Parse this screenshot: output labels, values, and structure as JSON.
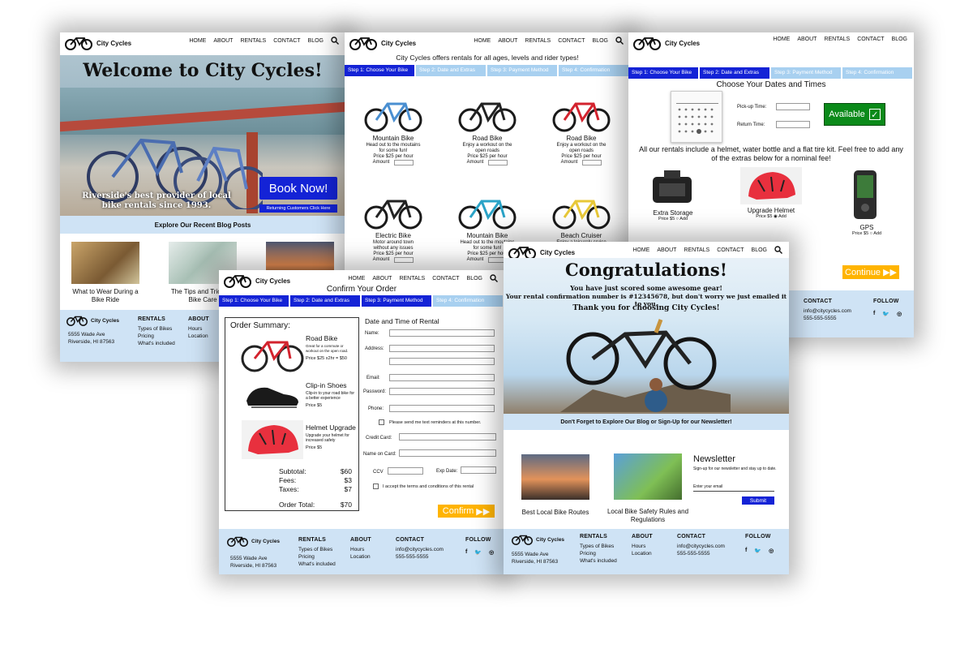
{
  "brand": {
    "name": "City Cycles",
    "accent": "#1423d6",
    "light_blue": "#cfe3f5",
    "yellow": "#ffb400"
  },
  "nav": {
    "home": "HOME",
    "about": "ABOUT",
    "rentals": "RENTALS",
    "contact": "CONTACT",
    "blog": "BLOG",
    "search_icon": "search-icon"
  },
  "steps": {
    "s1": "Step 1: Choose Your Bike",
    "s2": "Step 2: Date and Extras",
    "s3": "Step 3: Payment Method",
    "s4": "Step 4: Confirmation"
  },
  "footer": {
    "address1": "5555 Wade Ave",
    "address2": "Riverside, HI 87563",
    "rentals_h": "RENTALS",
    "rentals_items": [
      "Types of Bikes",
      "Pricing",
      "What's included"
    ],
    "about_h": "ABOUT",
    "about_items": [
      "Hours",
      "Location"
    ],
    "contact_h": "CONTACT",
    "email": "info@citycycles.com",
    "phone": "555-555-5555",
    "follow_h": "FOLLOW",
    "social": [
      "f",
      "t",
      "o"
    ]
  },
  "home": {
    "title": "Welcome to City Cycles!",
    "tagline": "Riverside's best provider of local bike rentals since 1993.",
    "book": "Book Now!",
    "returning": "Returning Customers Click Here",
    "blog_header": "Explore Our Recent Blog Posts",
    "post1": "What to Wear During a Bike Ride",
    "post2": "The Tips and Tricks of Bike Care"
  },
  "choose": {
    "intro": "City Cycles offers rentals for all ages, levels and rider types!",
    "bikes": [
      {
        "name": "Mountain Bike",
        "desc": "Head out to the moutains for some fun!",
        "price": "Price   $25 per hour",
        "amount": "Amount"
      },
      {
        "name": "Road Bike",
        "desc": "Enjoy a workout on the open roads",
        "price": "Price   $25 per hour",
        "amount": "Amount"
      },
      {
        "name": "Road Bike",
        "desc": "Enjoy a workout on the open roads",
        "price": "Price   $25 per hour",
        "amount": "Amount"
      },
      {
        "name": "Electric Bike",
        "desc": "Motor around town without any issues",
        "price": "Price   $25 per hour",
        "amount": "Amount"
      },
      {
        "name": "Mountain Bike",
        "desc": "Head out to the moutains for some fun!",
        "price": "Price   $25 per hour",
        "amount": "Amount"
      },
      {
        "name": "Beach Cruiser",
        "desc": "Enjoy a leisurely cruise",
        "price": "",
        "amount": ""
      }
    ]
  },
  "dates": {
    "heading": "Choose Your Dates and Times",
    "pickup": "Pick-up Time:",
    "return": "Return Time:",
    "available": "Available",
    "extras_text": "All our rentals include a helmet, water bottle and a flat tire kit. Feel free to add any of the extras below for a nominal fee!",
    "extras": [
      {
        "name": "Extra Storage",
        "price": "Price  $5",
        "add": "Add"
      },
      {
        "name": "Upgrade Helmet",
        "price": "Price  $5",
        "add": "Add"
      },
      {
        "name": "GPS",
        "price": "Price  $5",
        "add": "Add"
      }
    ],
    "continue": "Continue"
  },
  "confirm": {
    "heading": "Confirm Your Order",
    "summary": "Order Summary:",
    "items": [
      {
        "name": "Road Bike",
        "desc": "Great for a commute or workout on the open road.",
        "price": "Price   $25 x2hr = $50"
      },
      {
        "name": "Clip-in Shoes",
        "desc": "Clip-in to your road bike for a better experience",
        "price": "Price   $5"
      },
      {
        "name": "Helmet Upgrade",
        "desc": "Upgrade your helmet for increased safety",
        "price": "Price   $5"
      }
    ],
    "subtotal_l": "Subtotal:",
    "subtotal": "$60",
    "fees_l": "Fees:",
    "fees": "$3",
    "taxes_l": "Taxes:",
    "taxes": "$7",
    "total_l": "Order Total:",
    "total": "$70",
    "form_heading": "Date and Time of Rental",
    "name": "Name:",
    "address": "Address:",
    "email": "Email:",
    "password": "Password:",
    "phone": "Phone:",
    "sms": "Please send me text reminders at this number.",
    "cc": "Credit Card:",
    "name_on_card": "Name on Card:",
    "ccv": "CCV",
    "exp": "Exp Date:",
    "terms": "I accept the terms and conditions of this rental",
    "confirm_btn": "Confirm"
  },
  "congrats": {
    "title": "Congratulations!",
    "line1": "You have just scored some awesome gear!",
    "line2": "Your rental confirmation number is #12345678, but don't worry we just emailed it to you.",
    "line3": "Thank you for choosing City Cycles!",
    "banner": "Don't Forget to Explore Our Blog or Sign-Up for our Newsletter!",
    "post1": "Best Local Bike Routes",
    "post2": "Local Bike Safety Rules and Regulations",
    "newsletter": "Newsletter",
    "news_sub": "Sign-up for our newsletter and stay up to date.",
    "email_ph": "Enter your email",
    "submit": "Submit"
  }
}
